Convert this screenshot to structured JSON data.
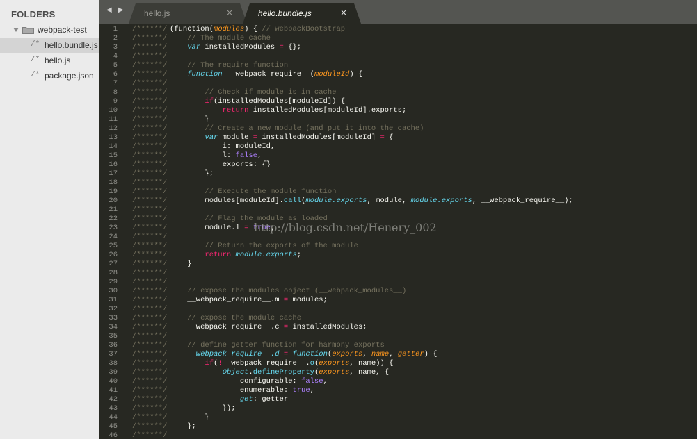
{
  "sidebar": {
    "title": "FOLDERS",
    "folder": "webpack-test",
    "file_icon": "/*",
    "files": [
      "hello.bundle.js",
      "hello.js",
      "package.json"
    ],
    "selected_index": 0
  },
  "tabs": [
    {
      "title": "hello.js",
      "active": false,
      "close": "×"
    },
    {
      "title": "hello.bundle.js",
      "active": true,
      "close": "×"
    }
  ],
  "nav_arrows": "◀ ▶",
  "watermark": "http://blog.csdn.net/Henery_002",
  "editor": {
    "gutter_comment": "/******/",
    "lines": [
      [
        [
          "n",
          "(function("
        ],
        [
          "p",
          "modules"
        ],
        [
          "n",
          ") { "
        ],
        [
          "c",
          "// webpackBootstrap"
        ]
      ],
      [
        [
          "c",
          "    // The module cache"
        ]
      ],
      [
        [
          "s",
          "    var"
        ],
        [
          "n",
          " installedModules "
        ],
        [
          "k",
          "="
        ],
        [
          "n",
          " {};"
        ]
      ],
      [],
      [
        [
          "c",
          "    // The require function"
        ]
      ],
      [
        [
          "s",
          "    function"
        ],
        [
          "n",
          " __webpack_require__("
        ],
        [
          "p",
          "moduleId"
        ],
        [
          "n",
          ") {"
        ]
      ],
      [],
      [
        [
          "c",
          "        // Check if module is in cache"
        ]
      ],
      [
        [
          "k",
          "        if"
        ],
        [
          "n",
          "(installedModules[moduleId]) {"
        ]
      ],
      [
        [
          "k",
          "            return"
        ],
        [
          "n",
          " installedModules[moduleId].exports;"
        ]
      ],
      [
        [
          "n",
          "        }"
        ]
      ],
      [
        [
          "c",
          "        // Create a new module (and put it into the cache)"
        ]
      ],
      [
        [
          "s",
          "        var"
        ],
        [
          "n",
          " module "
        ],
        [
          "k",
          "="
        ],
        [
          "n",
          " installedModules[moduleId] "
        ],
        [
          "k",
          "="
        ],
        [
          "n",
          " {"
        ]
      ],
      [
        [
          "n",
          "            i: moduleId,"
        ]
      ],
      [
        [
          "n",
          "            l: "
        ],
        [
          "num",
          "false"
        ],
        [
          "n",
          ","
        ]
      ],
      [
        [
          "n",
          "            exports: {}"
        ]
      ],
      [
        [
          "n",
          "        };"
        ]
      ],
      [],
      [
        [
          "c",
          "        // Execute the module function"
        ]
      ],
      [
        [
          "n",
          "        modules[moduleId]."
        ],
        [
          "f",
          "call"
        ],
        [
          "n",
          "("
        ],
        [
          "s",
          "module.exports"
        ],
        [
          "n",
          ", module, "
        ],
        [
          "s",
          "module.exports"
        ],
        [
          "n",
          ", __webpack_require__);"
        ]
      ],
      [],
      [
        [
          "c",
          "        // Flag the module as loaded"
        ]
      ],
      [
        [
          "n",
          "        module.l "
        ],
        [
          "k",
          "="
        ],
        [
          "n",
          " "
        ],
        [
          "num",
          "true"
        ],
        [
          "n",
          ";"
        ]
      ],
      [],
      [
        [
          "c",
          "        // Return the exports of the module"
        ]
      ],
      [
        [
          "k",
          "        return"
        ],
        [
          "n",
          " "
        ],
        [
          "s",
          "module.exports"
        ],
        [
          "n",
          ";"
        ]
      ],
      [
        [
          "n",
          "    }"
        ]
      ],
      [],
      [],
      [
        [
          "c",
          "    // expose the modules object (__webpack_modules__)"
        ]
      ],
      [
        [
          "n",
          "    __webpack_require__.m "
        ],
        [
          "k",
          "="
        ],
        [
          "n",
          " modules;"
        ]
      ],
      [],
      [
        [
          "c",
          "    // expose the module cache"
        ]
      ],
      [
        [
          "n",
          "    __webpack_require__.c "
        ],
        [
          "k",
          "="
        ],
        [
          "n",
          " installedModules;"
        ]
      ],
      [],
      [
        [
          "c",
          "    // define getter function for harmony exports"
        ]
      ],
      [
        [
          "fi",
          "    __webpack_require__.d"
        ],
        [
          "n",
          " "
        ],
        [
          "k",
          "="
        ],
        [
          "n",
          " "
        ],
        [
          "s",
          "function"
        ],
        [
          "n",
          "("
        ],
        [
          "p",
          "exports"
        ],
        [
          "n",
          ", "
        ],
        [
          "p",
          "name"
        ],
        [
          "n",
          ", "
        ],
        [
          "p",
          "getter"
        ],
        [
          "n",
          ") {"
        ]
      ],
      [
        [
          "k",
          "        if"
        ],
        [
          "n",
          "("
        ],
        [
          "k",
          "!"
        ],
        [
          "n",
          "__webpack_require__."
        ],
        [
          "f",
          "o"
        ],
        [
          "n",
          "("
        ],
        [
          "p",
          "exports"
        ],
        [
          "n",
          ", name)) {"
        ]
      ],
      [
        [
          "s",
          "            Object"
        ],
        [
          "n",
          "."
        ],
        [
          "f",
          "defineProperty"
        ],
        [
          "n",
          "("
        ],
        [
          "p",
          "exports"
        ],
        [
          "n",
          ", name, {"
        ]
      ],
      [
        [
          "n",
          "                configurable: "
        ],
        [
          "num",
          "false"
        ],
        [
          "n",
          ","
        ]
      ],
      [
        [
          "n",
          "                enumerable: "
        ],
        [
          "num",
          "true"
        ],
        [
          "n",
          ","
        ]
      ],
      [
        [
          "s",
          "                get"
        ],
        [
          "n",
          ": getter"
        ]
      ],
      [
        [
          "n",
          "            });"
        ]
      ],
      [
        [
          "n",
          "        }"
        ]
      ],
      [
        [
          "n",
          "    };"
        ]
      ],
      []
    ]
  }
}
